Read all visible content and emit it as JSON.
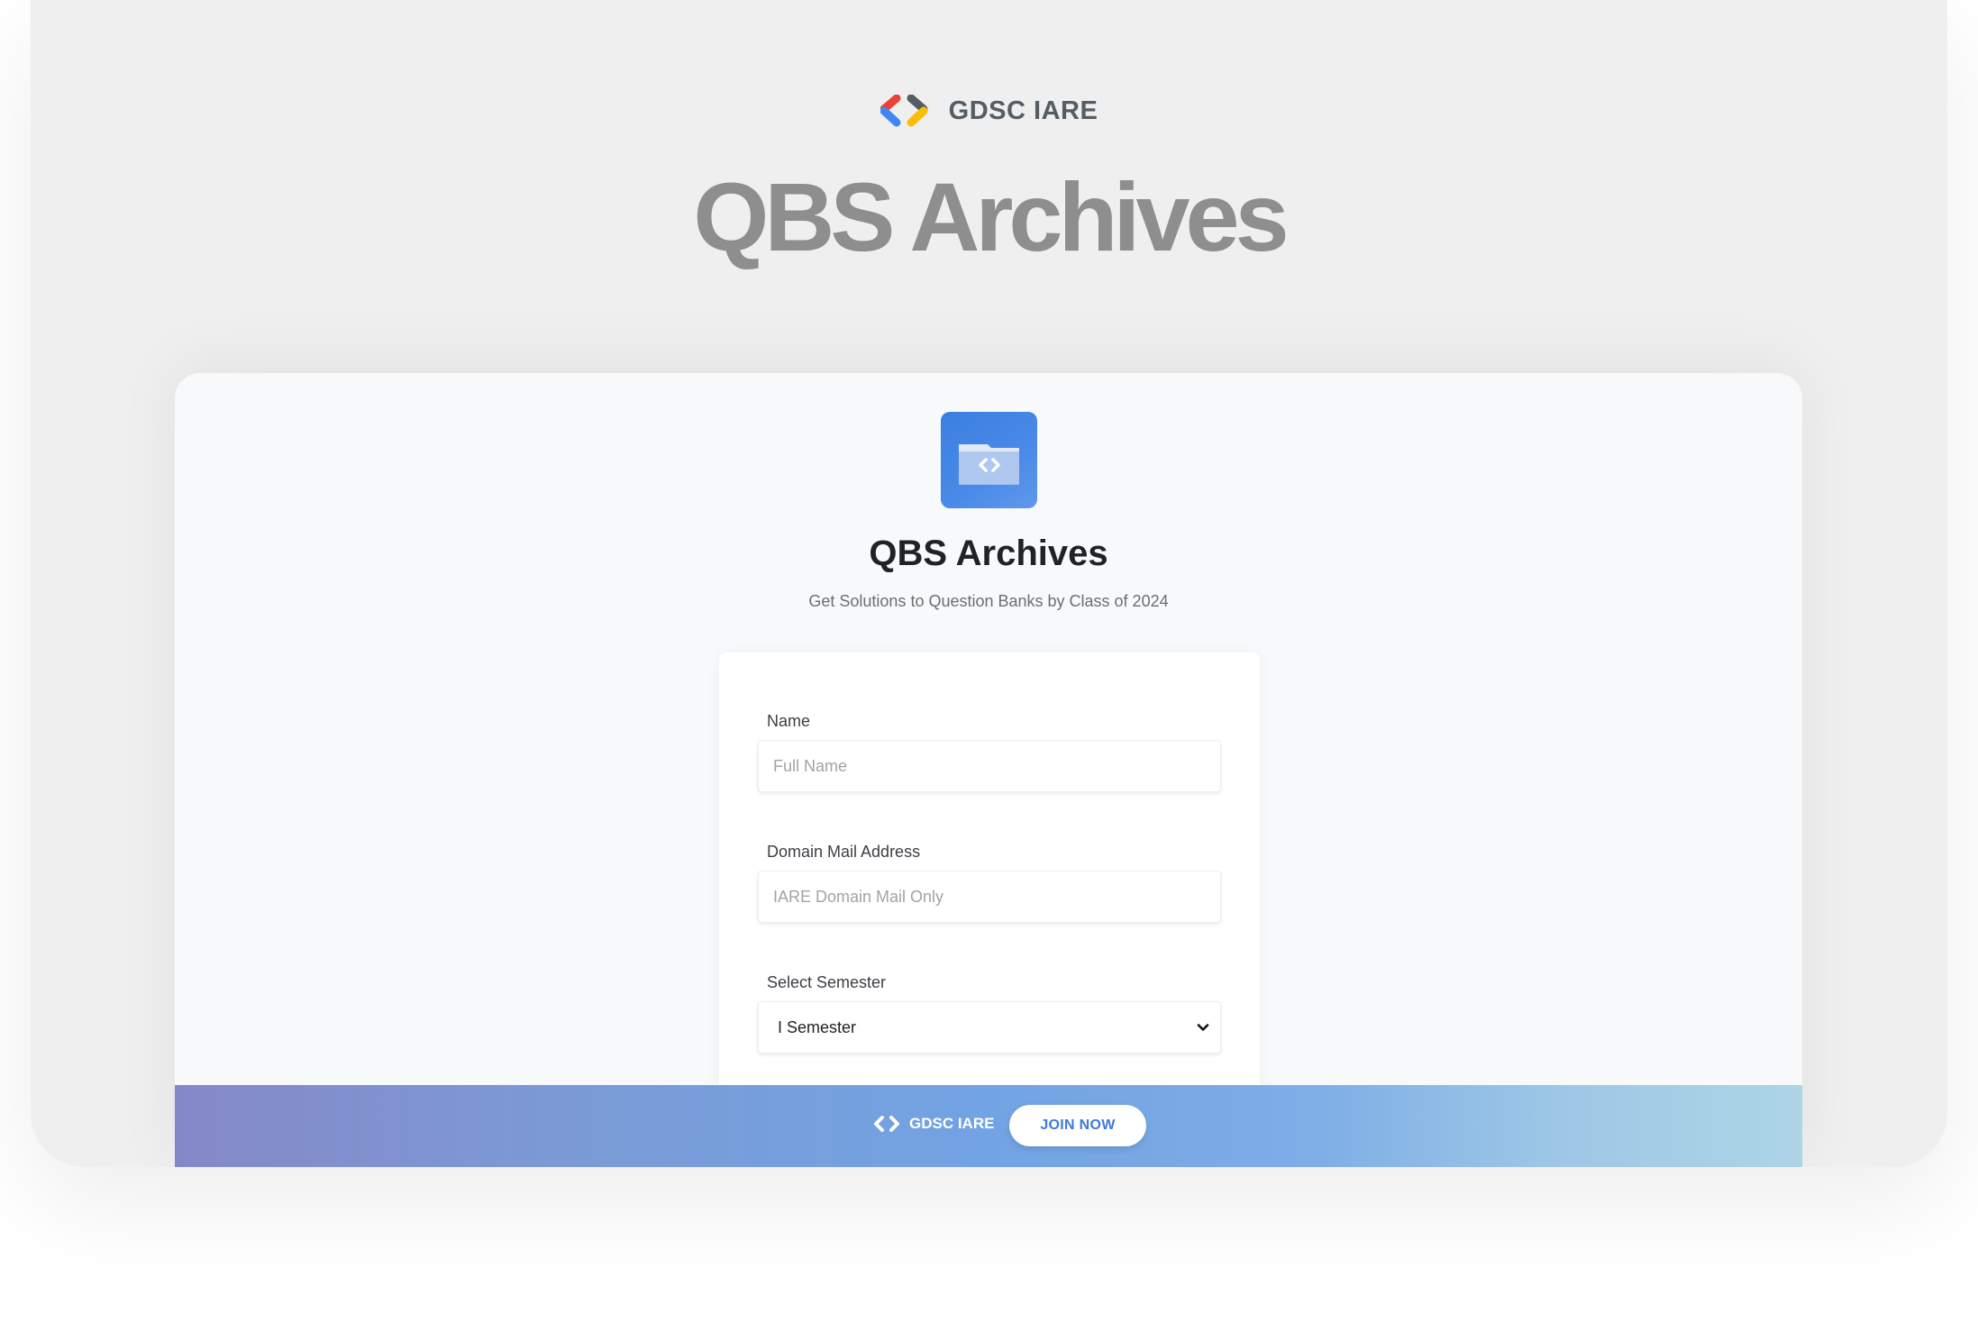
{
  "header": {
    "brand": "GDSC IARE",
    "hero_title": "QBS Archives"
  },
  "card": {
    "title": "QBS Archives",
    "subtitle": "Get Solutions to Question Banks by Class of 2024",
    "icon": "code-folder-icon"
  },
  "form": {
    "name_label": "Name",
    "name_placeholder": "Full Name",
    "mail_label": "Domain Mail Address",
    "mail_placeholder": "IARE Domain Mail Only",
    "semester_label": "Select Semester",
    "semester_selected": "I Semester"
  },
  "footer": {
    "brand": "GDSC IARE",
    "join_label": "JOIN NOW"
  },
  "colors": {
    "accent_blue": "#3f7ad6",
    "logo_red": "#ea4335",
    "logo_blue": "#4285f4",
    "logo_yellow": "#fbbc04",
    "logo_dark": "#555d63"
  }
}
